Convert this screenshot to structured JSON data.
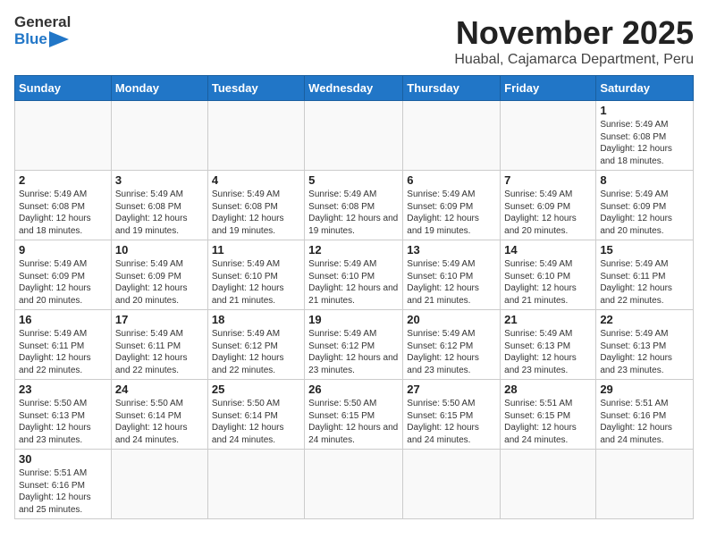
{
  "header": {
    "logo_general": "General",
    "logo_blue": "Blue",
    "title": "November 2025",
    "subtitle": "Huabal, Cajamarca Department, Peru"
  },
  "days_of_week": [
    "Sunday",
    "Monday",
    "Tuesday",
    "Wednesday",
    "Thursday",
    "Friday",
    "Saturday"
  ],
  "weeks": [
    [
      {
        "day": "",
        "info": ""
      },
      {
        "day": "",
        "info": ""
      },
      {
        "day": "",
        "info": ""
      },
      {
        "day": "",
        "info": ""
      },
      {
        "day": "",
        "info": ""
      },
      {
        "day": "",
        "info": ""
      },
      {
        "day": "1",
        "info": "Sunrise: 5:49 AM\nSunset: 6:08 PM\nDaylight: 12 hours and 18 minutes."
      }
    ],
    [
      {
        "day": "2",
        "info": "Sunrise: 5:49 AM\nSunset: 6:08 PM\nDaylight: 12 hours and 18 minutes."
      },
      {
        "day": "3",
        "info": "Sunrise: 5:49 AM\nSunset: 6:08 PM\nDaylight: 12 hours and 19 minutes."
      },
      {
        "day": "4",
        "info": "Sunrise: 5:49 AM\nSunset: 6:08 PM\nDaylight: 12 hours and 19 minutes."
      },
      {
        "day": "5",
        "info": "Sunrise: 5:49 AM\nSunset: 6:08 PM\nDaylight: 12 hours and 19 minutes."
      },
      {
        "day": "6",
        "info": "Sunrise: 5:49 AM\nSunset: 6:09 PM\nDaylight: 12 hours and 19 minutes."
      },
      {
        "day": "7",
        "info": "Sunrise: 5:49 AM\nSunset: 6:09 PM\nDaylight: 12 hours and 20 minutes."
      },
      {
        "day": "8",
        "info": "Sunrise: 5:49 AM\nSunset: 6:09 PM\nDaylight: 12 hours and 20 minutes."
      }
    ],
    [
      {
        "day": "9",
        "info": "Sunrise: 5:49 AM\nSunset: 6:09 PM\nDaylight: 12 hours and 20 minutes."
      },
      {
        "day": "10",
        "info": "Sunrise: 5:49 AM\nSunset: 6:09 PM\nDaylight: 12 hours and 20 minutes."
      },
      {
        "day": "11",
        "info": "Sunrise: 5:49 AM\nSunset: 6:10 PM\nDaylight: 12 hours and 21 minutes."
      },
      {
        "day": "12",
        "info": "Sunrise: 5:49 AM\nSunset: 6:10 PM\nDaylight: 12 hours and 21 minutes."
      },
      {
        "day": "13",
        "info": "Sunrise: 5:49 AM\nSunset: 6:10 PM\nDaylight: 12 hours and 21 minutes."
      },
      {
        "day": "14",
        "info": "Sunrise: 5:49 AM\nSunset: 6:10 PM\nDaylight: 12 hours and 21 minutes."
      },
      {
        "day": "15",
        "info": "Sunrise: 5:49 AM\nSunset: 6:11 PM\nDaylight: 12 hours and 22 minutes."
      }
    ],
    [
      {
        "day": "16",
        "info": "Sunrise: 5:49 AM\nSunset: 6:11 PM\nDaylight: 12 hours and 22 minutes."
      },
      {
        "day": "17",
        "info": "Sunrise: 5:49 AM\nSunset: 6:11 PM\nDaylight: 12 hours and 22 minutes."
      },
      {
        "day": "18",
        "info": "Sunrise: 5:49 AM\nSunset: 6:12 PM\nDaylight: 12 hours and 22 minutes."
      },
      {
        "day": "19",
        "info": "Sunrise: 5:49 AM\nSunset: 6:12 PM\nDaylight: 12 hours and 23 minutes."
      },
      {
        "day": "20",
        "info": "Sunrise: 5:49 AM\nSunset: 6:12 PM\nDaylight: 12 hours and 23 minutes."
      },
      {
        "day": "21",
        "info": "Sunrise: 5:49 AM\nSunset: 6:13 PM\nDaylight: 12 hours and 23 minutes."
      },
      {
        "day": "22",
        "info": "Sunrise: 5:49 AM\nSunset: 6:13 PM\nDaylight: 12 hours and 23 minutes."
      }
    ],
    [
      {
        "day": "23",
        "info": "Sunrise: 5:50 AM\nSunset: 6:13 PM\nDaylight: 12 hours and 23 minutes."
      },
      {
        "day": "24",
        "info": "Sunrise: 5:50 AM\nSunset: 6:14 PM\nDaylight: 12 hours and 24 minutes."
      },
      {
        "day": "25",
        "info": "Sunrise: 5:50 AM\nSunset: 6:14 PM\nDaylight: 12 hours and 24 minutes."
      },
      {
        "day": "26",
        "info": "Sunrise: 5:50 AM\nSunset: 6:15 PM\nDaylight: 12 hours and 24 minutes."
      },
      {
        "day": "27",
        "info": "Sunrise: 5:50 AM\nSunset: 6:15 PM\nDaylight: 12 hours and 24 minutes."
      },
      {
        "day": "28",
        "info": "Sunrise: 5:51 AM\nSunset: 6:15 PM\nDaylight: 12 hours and 24 minutes."
      },
      {
        "day": "29",
        "info": "Sunrise: 5:51 AM\nSunset: 6:16 PM\nDaylight: 12 hours and 24 minutes."
      }
    ],
    [
      {
        "day": "30",
        "info": "Sunrise: 5:51 AM\nSunset: 6:16 PM\nDaylight: 12 hours and 25 minutes."
      },
      {
        "day": "",
        "info": ""
      },
      {
        "day": "",
        "info": ""
      },
      {
        "day": "",
        "info": ""
      },
      {
        "day": "",
        "info": ""
      },
      {
        "day": "",
        "info": ""
      },
      {
        "day": "",
        "info": ""
      }
    ]
  ]
}
